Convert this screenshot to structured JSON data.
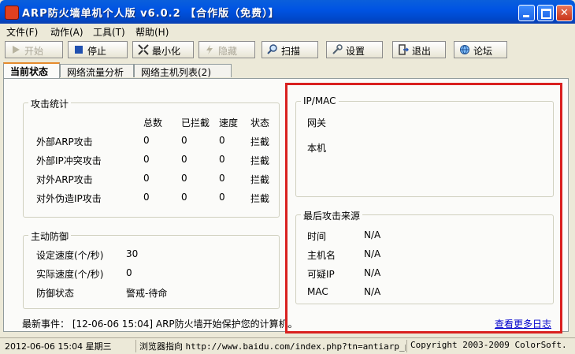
{
  "window": {
    "title": "ARP防火墙单机个人版 v6.0.2 【合作版（免费）】"
  },
  "menu": [
    "文件(F)",
    "动作(A)",
    "工具(T)",
    "帮助(H)"
  ],
  "toolbar": {
    "start": "开始",
    "stop": "停止",
    "minimize": "最小化",
    "hide": "隐藏",
    "scan": "扫描",
    "settings": "设置",
    "exit": "退出",
    "forum": "论坛"
  },
  "tabs": [
    "当前状态",
    "网络流量分析",
    "网络主机列表(2)"
  ],
  "attack_stats": {
    "title": "攻击统计",
    "headers": [
      "总数",
      "已拦截",
      "速度",
      "状态"
    ],
    "rows": [
      {
        "name": "外部ARP攻击",
        "total": "0",
        "blocked": "0",
        "speed": "0",
        "status": "拦截"
      },
      {
        "name": "外部IP冲突攻击",
        "total": "0",
        "blocked": "0",
        "speed": "0",
        "status": "拦截"
      },
      {
        "name": "对外ARP攻击",
        "total": "0",
        "blocked": "0",
        "speed": "0",
        "status": "拦截"
      },
      {
        "name": "对外伪造IP攻击",
        "total": "0",
        "blocked": "0",
        "speed": "0",
        "status": "拦截"
      }
    ]
  },
  "active_defense": {
    "title": "主动防御",
    "rows": [
      {
        "label": "设定速度(个/秒)",
        "value": "30"
      },
      {
        "label": "实际速度(个/秒)",
        "value": "0"
      },
      {
        "label": "防御状态",
        "value": "警戒-待命"
      }
    ]
  },
  "ip_mac": {
    "title": "IP/MAC",
    "gateway_label": "网关",
    "local_label": "本机"
  },
  "last_attack": {
    "title": "最后攻击来源",
    "rows": [
      {
        "label": "时间",
        "value": "N/A"
      },
      {
        "label": "主机名",
        "value": "N/A"
      },
      {
        "label": "可疑IP",
        "value": "N/A"
      },
      {
        "label": "MAC",
        "value": "N/A"
      }
    ]
  },
  "events": {
    "label": "最新事件：",
    "text": "[12-06-06 15:04] ARP防火墙开始保护您的计算机。",
    "more_log": "查看更多日志"
  },
  "statusbar": {
    "datetime": "2012-06-06 15:04 星期三",
    "browser_label": "浏览器指向",
    "browser_url": "http://www.baidu.com/index.php?tn=antiarp_pg",
    "copyright": "Copyright 2003-2009 ColorSoft."
  },
  "colors": {
    "highlight": "#d9201f",
    "titlebar": "#0054e3",
    "link": "#0000cc"
  }
}
